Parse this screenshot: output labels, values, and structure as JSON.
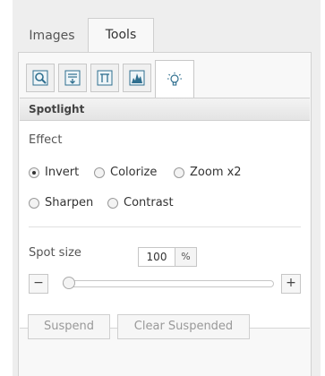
{
  "tabs": [
    {
      "label": "Images"
    },
    {
      "label": "Tools",
      "active": true
    }
  ],
  "toolbar": {
    "icons": [
      "zoom-icon",
      "enhance-icon",
      "adjust-icon",
      "histogram-icon",
      "spotlight-icon"
    ],
    "active_index": 4
  },
  "section": {
    "title": "Spotlight"
  },
  "effect": {
    "label": "Effect",
    "options": [
      {
        "label": "Invert",
        "checked": true
      },
      {
        "label": "Colorize",
        "checked": false
      },
      {
        "label": "Zoom x2",
        "checked": false
      },
      {
        "label": "Sharpen",
        "checked": false
      },
      {
        "label": "Contrast",
        "checked": false
      }
    ]
  },
  "spot_size": {
    "label": "Spot size",
    "value": "100",
    "unit": "%",
    "minus_label": "−",
    "plus_label": "+",
    "slider_fraction": 0.0
  },
  "buttons": {
    "suspend": "Suspend",
    "clear_suspended": "Clear Suspended"
  },
  "colors": {
    "panel_bg": "#eeeeee",
    "content_bg": "#f8f8f8",
    "border": "#cfcfcf",
    "disabled_text": "#999999"
  }
}
